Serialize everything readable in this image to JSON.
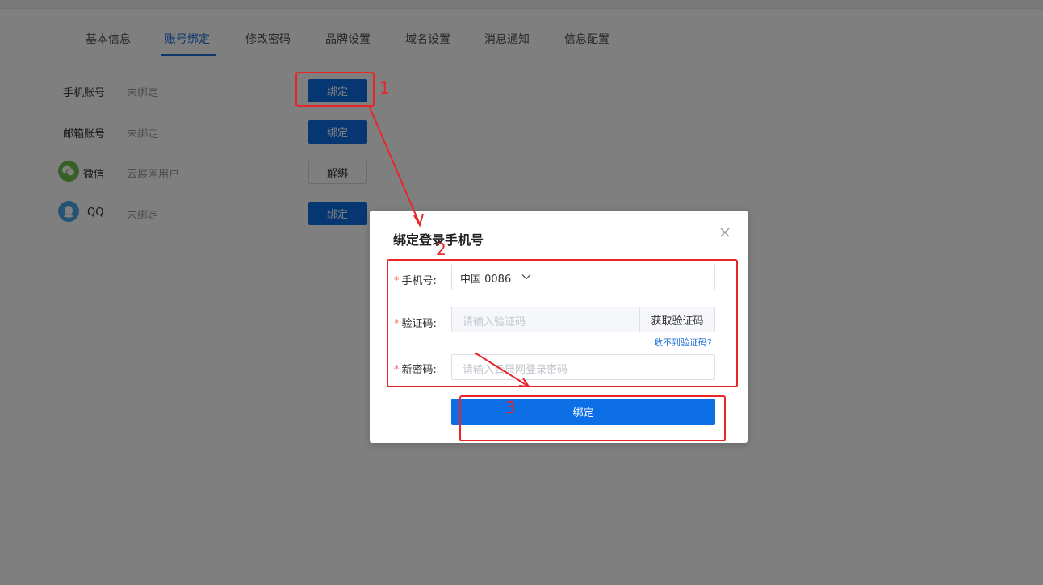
{
  "tabs": [
    {
      "label": "基本信息"
    },
    {
      "label": "账号绑定"
    },
    {
      "label": "修改密码"
    },
    {
      "label": "品牌设置"
    },
    {
      "label": "域名设置"
    },
    {
      "label": "消息通知"
    },
    {
      "label": "信息配置"
    }
  ],
  "active_tab": "账号绑定",
  "accounts": [
    {
      "label": "手机账号",
      "status": "未绑定",
      "action": "绑定"
    },
    {
      "label": "邮箱账号",
      "status": "未绑定",
      "action": "绑定"
    },
    {
      "label": "微信",
      "status": "云展网用户",
      "action": "解绑",
      "icon": "wechat-icon"
    },
    {
      "label": "QQ",
      "status": "未绑定",
      "action": "绑定",
      "icon": "qq-icon"
    }
  ],
  "modal": {
    "title": "绑定登录手机号",
    "phone_label": "手机号:",
    "country_code": "中国 0086",
    "phone_value": "",
    "code_label": "验证码:",
    "code_placeholder": "请输入验证码",
    "get_code_button": "获取验证码",
    "no_code_link": "收不到验证码?",
    "password_label": "新密码:",
    "password_placeholder": "请输入云展网登录密码",
    "submit_button": "绑定",
    "required_mark": "*"
  },
  "annotations": [
    "1",
    "2",
    "3"
  ],
  "colors": {
    "primary": "#0d6fe6",
    "annotation": "#e8262a",
    "required": "#f56c6c"
  }
}
